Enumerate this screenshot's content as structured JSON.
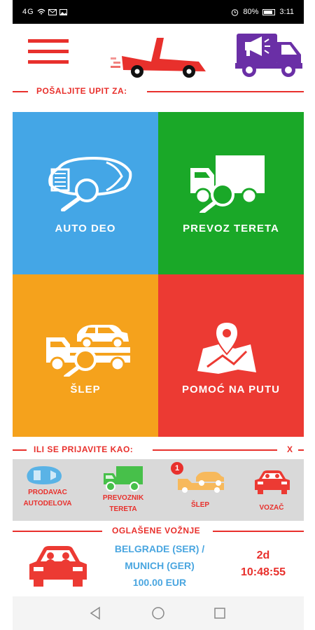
{
  "status_bar": {
    "signal": "4G",
    "battery_percent": "80%",
    "time": "3:11"
  },
  "header": {
    "menu_icon": "hamburger-menu-icon",
    "logo_icon": "tow-truck-logo",
    "action_icon": "megaphone-truck-icon"
  },
  "send_request": {
    "label": "POŠALJITE UPIT ZA:"
  },
  "tiles": [
    {
      "label": "AUTO DEO",
      "icon": "car-part-search-icon",
      "color": "#44a6e6"
    },
    {
      "label": "PREVOZ TERETA",
      "icon": "cargo-truck-search-icon",
      "color": "#1aa828"
    },
    {
      "label": "ŠLEP",
      "icon": "tow-truck-search-icon",
      "color": "#f5a21c"
    },
    {
      "label": "POMOĆ NA PUTU",
      "icon": "map-pin-icon",
      "color": "#ec3a33"
    }
  ],
  "login_as": {
    "label": "ILI SE PRIJAVITE KAO:",
    "close": "X"
  },
  "roles": [
    {
      "label_line1": "PRODAVAC",
      "label_line2": "AUTODELOVA",
      "icon": "car-icon",
      "color": "#5ab3e6"
    },
    {
      "label_line1": "PREVOZNIK",
      "label_line2": "TERETA",
      "icon": "truck-icon",
      "color": "#47c04a"
    },
    {
      "label_line1": "ŠLEP",
      "label_line2": "",
      "icon": "tow-truck-icon",
      "color": "#f7b95c",
      "badge": "1"
    },
    {
      "label_line1": "VOZAČ",
      "label_line2": "",
      "icon": "passenger-car-icon",
      "color": "#ec3a33"
    }
  ],
  "announced_rides": {
    "label": "OGLAŠENE VOŽNJE",
    "route_line1": "BELGRADE (SER) /",
    "route_line2": "MUNICH (GER)",
    "price": "100.00 EUR",
    "time_days": "2d",
    "time_clock": "10:48:55"
  },
  "nav": {
    "back": "back-icon",
    "home": "home-icon",
    "recents": "recents-icon"
  }
}
